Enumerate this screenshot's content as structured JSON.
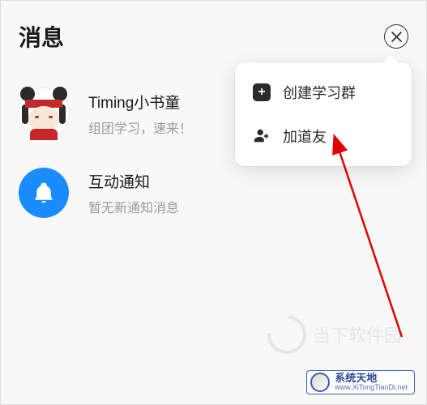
{
  "header": {
    "title": "消息"
  },
  "items": [
    {
      "title": "Timing小书童",
      "subtitle": "组团学习，速来！"
    },
    {
      "title": "互动通知",
      "subtitle": "暂无新通知消息"
    }
  ],
  "popup": {
    "create_label": "创建学习群",
    "add_friend_label": "加道友"
  },
  "watermark": {
    "brand": "当下软件园",
    "footer_main": "系统天地",
    "footer_sub": "www.XiTongTianDi.net"
  }
}
